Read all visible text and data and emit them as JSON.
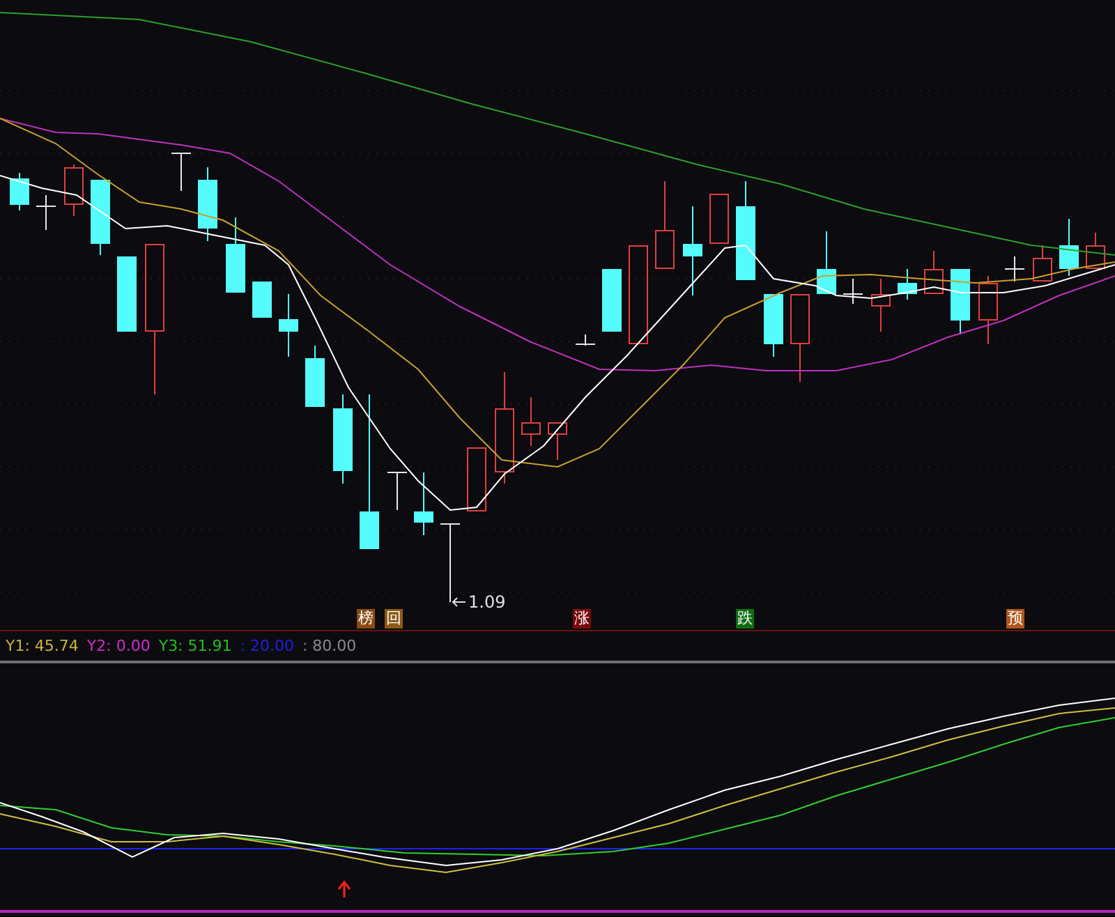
{
  "price_chart": {
    "low_label": "1.09",
    "markers": [
      {
        "text": "榜",
        "color": "#8a4a12"
      },
      {
        "text": "回",
        "color": "#8a5a14"
      },
      {
        "text": "涨",
        "color": "#7a0a0a"
      },
      {
        "text": "跌",
        "color": "#0f6e12"
      },
      {
        "text": "预",
        "color": "#b0561c"
      }
    ]
  },
  "indicator_legend": [
    {
      "text": "Y1: 45.74",
      "color": "#c8b43c"
    },
    {
      "text": "Y2: 0.00",
      "color": "#d02ad0"
    },
    {
      "text": "Y3: 51.91",
      "color": "#22c022"
    },
    {
      "text": ": 20.00",
      "color": "#2020e0"
    },
    {
      "text": ": 80.00",
      "color": "#8a8a8a"
    }
  ]
}
